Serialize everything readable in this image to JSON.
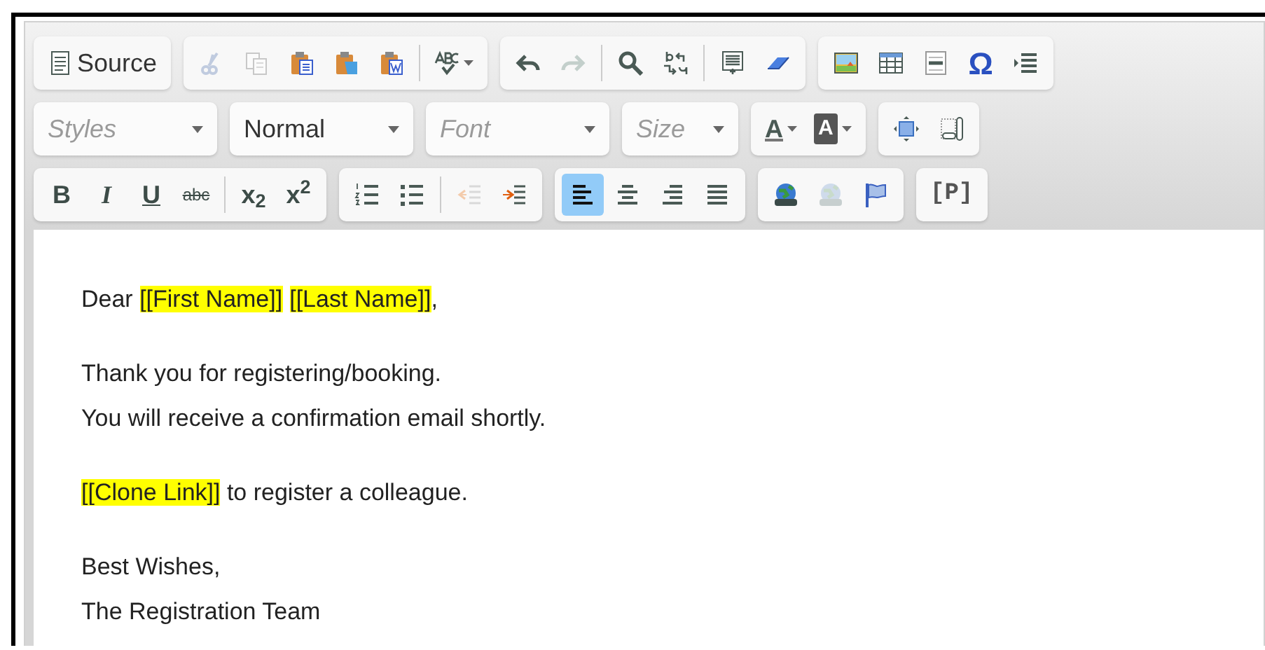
{
  "toolbar": {
    "rows": [
      [
        {
          "items": [
            {
              "kind": "button",
              "label": "Source",
              "disabled": false
            }
          ]
        },
        {
          "items": [
            {
              "kind": "button",
              "disabled": true
            },
            {
              "kind": "button",
              "disabled": true
            },
            {
              "kind": "button",
              "disabled": false
            },
            {
              "kind": "button",
              "disabled": false
            },
            {
              "kind": "button",
              "disabled": false
            },
            {
              "kind": "separator"
            },
            {
              "kind": "menu-button",
              "disabled": false
            }
          ]
        },
        {
          "items": [
            {
              "kind": "button",
              "disabled": false
            },
            {
              "kind": "button",
              "disabled": true
            },
            {
              "kind": "separator"
            },
            {
              "kind": "button",
              "disabled": false
            },
            {
              "kind": "button",
              "disabled": false
            },
            {
              "kind": "separator"
            },
            {
              "kind": "button",
              "disabled": false
            },
            {
              "kind": "button",
              "disabled": false
            }
          ]
        },
        {
          "items": [
            {
              "kind": "button",
              "disabled": false
            },
            {
              "kind": "button",
              "disabled": false
            },
            {
              "kind": "button",
              "disabled": false
            },
            {
              "kind": "button",
              "label": "Ω",
              "disabled": false
            },
            {
              "kind": "button",
              "disabled": false
            }
          ]
        }
      ],
      [
        {
          "items": [
            {
              "kind": "combo",
              "placeholder": "Styles"
            }
          ]
        },
        {
          "items": [
            {
              "kind": "combo",
              "value": "Normal"
            }
          ]
        },
        {
          "items": [
            {
              "kind": "combo",
              "placeholder": "Font"
            }
          ]
        },
        {
          "items": [
            {
              "kind": "combo",
              "placeholder": "Size"
            }
          ]
        },
        {
          "items": [
            {
              "kind": "menu-button",
              "label": "A",
              "disabled": false
            },
            {
              "kind": "menu-button",
              "label": "A",
              "disabled": false
            }
          ]
        },
        {
          "items": [
            {
              "kind": "button",
              "disabled": false
            },
            {
              "kind": "button",
              "disabled": false
            }
          ]
        }
      ],
      [
        {
          "items": [
            {
              "kind": "button",
              "label": "B",
              "disabled": false
            },
            {
              "kind": "button",
              "label": "I",
              "disabled": false
            },
            {
              "kind": "button",
              "label": "U",
              "disabled": false
            },
            {
              "kind": "button",
              "label": "abc",
              "disabled": false
            },
            {
              "kind": "separator"
            },
            {
              "kind": "button",
              "label": "x$_{2}$",
              "disabled": false
            },
            {
              "kind": "button",
              "label": "x$^{2}$",
              "disabled": false
            }
          ]
        },
        {
          "items": [
            {
              "kind": "button",
              "disabled": false
            },
            {
              "kind": "button",
              "disabled": false
            },
            {
              "kind": "separator"
            },
            {
              "kind": "button",
              "disabled": true
            },
            {
              "kind": "button",
              "disabled": false
            }
          ]
        },
        {
          "items": [
            {
              "kind": "button",
              "disabled": false,
              "selected": true
            },
            {
              "kind": "button",
              "disabled": false,
              "selected": false
            },
            {
              "kind": "button",
              "disabled": false,
              "selected": false
            },
            {
              "kind": "button",
              "disabled": false,
              "selected": false
            }
          ]
        },
        {
          "items": [
            {
              "kind": "button",
              "disabled": false
            },
            {
              "kind": "button",
              "disabled": true
            },
            {
              "kind": "button",
              "disabled": false
            }
          ]
        },
        {
          "items": [
            {
              "kind": "button",
              "label": "[P]",
              "disabled": false
            }
          ]
        }
      ]
    ]
  },
  "content": {
    "paragraphs": [
      {
        "lines": [
          [
            {
              "text": "Dear "
            },
            {
              "text": "[[First Name]]",
              "highlighted": true
            },
            {
              "text": "[[Last Name]]",
              "highlighted": true,
              "spaced": true
            },
            {
              "text": ","
            }
          ]
        ]
      },
      {
        "lines": [
          [
            {
              "text": "Thank you for registering/booking."
            }
          ],
          [
            {
              "text": "You will receive a confirmation email shortly."
            }
          ]
        ]
      },
      {
        "lines": [
          [
            {
              "text": "[[Clone Link]]",
              "highlighted": true
            },
            {
              "text": " to register a colleague."
            }
          ]
        ]
      },
      {
        "lines": [
          [
            {
              "text": "Best Wishes,"
            }
          ],
          [
            {
              "text": "The Registration Team"
            }
          ]
        ]
      }
    ]
  }
}
